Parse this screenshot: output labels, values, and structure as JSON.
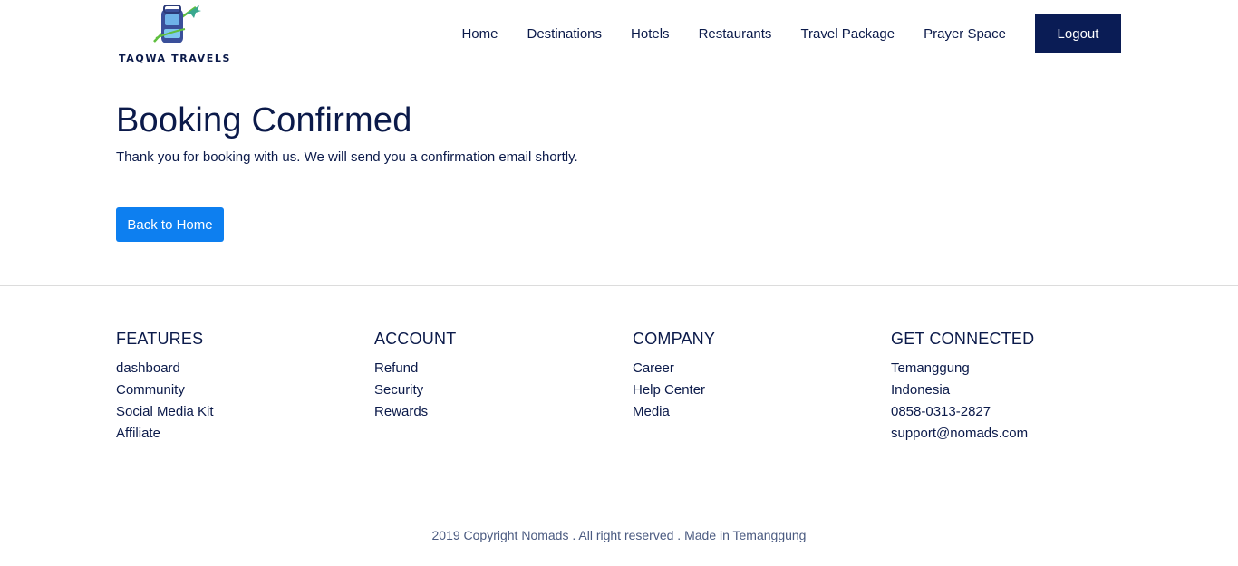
{
  "brand": {
    "name": "TAQWA TRAVELS",
    "icon": "backpack-plane-logo"
  },
  "nav": {
    "links": [
      "Home",
      "Destinations",
      "Hotels",
      "Restaurants",
      "Travel Package",
      "Prayer Space"
    ],
    "logout_label": "Logout"
  },
  "main": {
    "title": "Booking Confirmed",
    "message": "Thank you for booking with us. We will send you a confirmation email shortly.",
    "back_button": "Back to Home"
  },
  "footer": {
    "columns": [
      {
        "heading": "FEATURES",
        "items": [
          "dashboard",
          "Community",
          "Social Media Kit",
          "Affiliate"
        ]
      },
      {
        "heading": "ACCOUNT",
        "items": [
          "Refund",
          "Security",
          "Rewards"
        ]
      },
      {
        "heading": "COMPANY",
        "items": [
          "Career",
          "Help Center",
          "Media"
        ]
      },
      {
        "heading": "GET CONNECTED",
        "items": [
          "Temanggung",
          "Indonesia",
          "0858-0313-2827",
          "support@nomads.com"
        ]
      }
    ],
    "copyright": "2019 Copyright Nomads . All right reserved . Made in Temanggung"
  },
  "colors": {
    "navy": "#0a1c55",
    "primary_button": "#0d7ff0",
    "text": "#0b1a4a"
  }
}
